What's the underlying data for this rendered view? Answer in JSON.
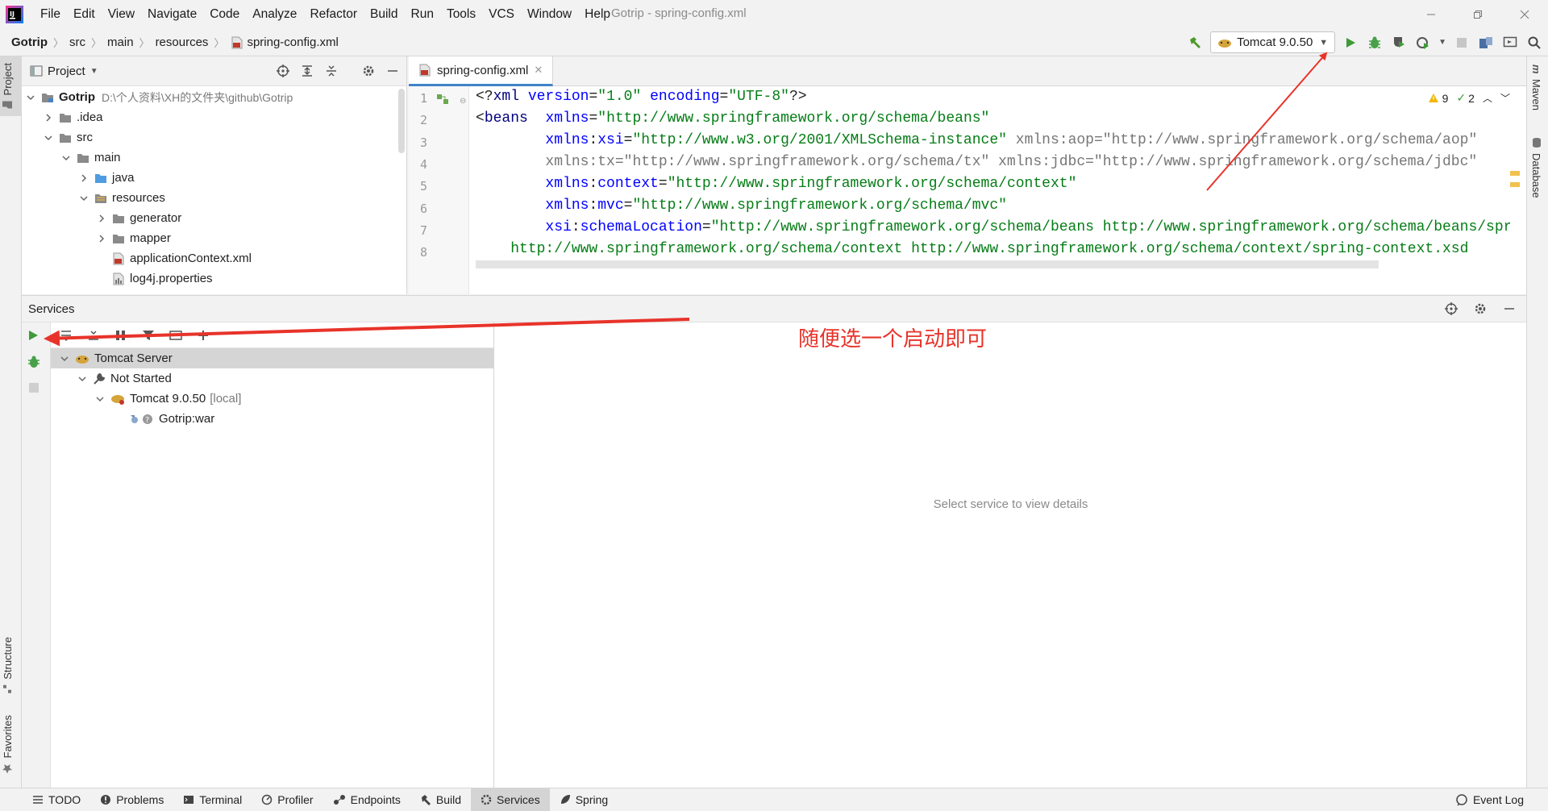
{
  "window": {
    "title": "Gotrip - spring-config.xml"
  },
  "menu": [
    "File",
    "Edit",
    "View",
    "Navigate",
    "Code",
    "Analyze",
    "Refactor",
    "Build",
    "Run",
    "Tools",
    "VCS",
    "Window",
    "Help"
  ],
  "breadcrumb": {
    "project": "Gotrip",
    "items": [
      "src",
      "main",
      "resources"
    ],
    "file": "spring-config.xml"
  },
  "run_config": {
    "label": "Tomcat 9.0.50"
  },
  "left_stripe": {
    "project": "Project",
    "structure": "Structure",
    "favorites": "Favorites"
  },
  "right_stripe": {
    "maven": "Maven",
    "database": "Database"
  },
  "project_panel": {
    "title": "Project",
    "tree": [
      {
        "name": "Gotrip",
        "hint": "D:\\个人资料\\XH的文件夹\\github\\Gotrip",
        "depth": 0,
        "kind": "module",
        "open": true
      },
      {
        "name": ".idea",
        "depth": 1,
        "kind": "folder",
        "open": false
      },
      {
        "name": "src",
        "depth": 1,
        "kind": "folder",
        "open": true
      },
      {
        "name": "main",
        "depth": 2,
        "kind": "folder",
        "open": true
      },
      {
        "name": "java",
        "depth": 3,
        "kind": "src-folder",
        "open": false
      },
      {
        "name": "resources",
        "depth": 3,
        "kind": "res-folder",
        "open": true
      },
      {
        "name": "generator",
        "depth": 4,
        "kind": "folder",
        "open": false
      },
      {
        "name": "mapper",
        "depth": 4,
        "kind": "folder",
        "open": false
      },
      {
        "name": "applicationContext.xml",
        "depth": 4,
        "kind": "xml"
      },
      {
        "name": "log4j.properties",
        "depth": 4,
        "kind": "props"
      }
    ]
  },
  "editor": {
    "tab": "spring-config.xml",
    "inspections": {
      "warnings": "9",
      "ok": "2"
    },
    "line_numbers": [
      "1",
      "2",
      "3",
      "4",
      "5",
      "6",
      "7",
      "8"
    ]
  },
  "services": {
    "title": "Services",
    "tree": [
      {
        "name": "Tomcat Server",
        "depth": 0,
        "kind": "server",
        "selected": true
      },
      {
        "name": "Not Started",
        "depth": 1,
        "kind": "group"
      },
      {
        "name": "Tomcat 9.0.50",
        "suffix": "[local]",
        "depth": 2,
        "kind": "tomcat"
      },
      {
        "name": "Gotrip:war",
        "depth": 3,
        "kind": "artifact"
      }
    ],
    "detail_placeholder": "Select service to view details"
  },
  "statusbar": {
    "items": [
      "TODO",
      "Problems",
      "Terminal",
      "Profiler",
      "Endpoints",
      "Build",
      "Services",
      "Spring"
    ],
    "active": "Services",
    "right": "Event Log"
  },
  "annotation": {
    "text": "随便选一个启动即可",
    "color": "#e8332a"
  },
  "colors": {
    "run_green": "#3d9a37",
    "accent_blue": "#4083c9",
    "debug_green": "#48a148"
  }
}
